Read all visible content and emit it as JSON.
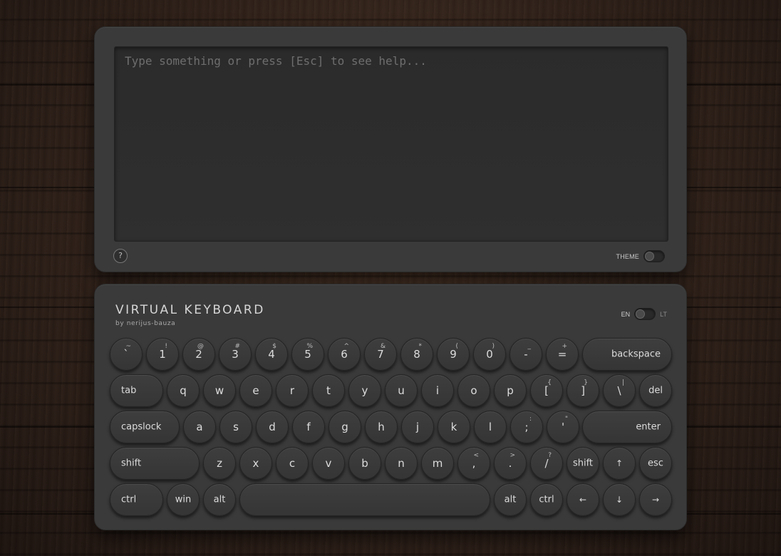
{
  "screen": {
    "placeholder": "Type something or press [Esc] to see help...",
    "help_label": "?",
    "theme_label": "THEME"
  },
  "keyboard": {
    "title": "VIRTUAL KEYBOARD",
    "author": "by nerijus-bauza",
    "lang_en": "EN",
    "lang_lt": "LT",
    "rows": [
      [
        {
          "label": "`",
          "shift": "~"
        },
        {
          "label": "1",
          "shift": "!"
        },
        {
          "label": "2",
          "shift": "@"
        },
        {
          "label": "3",
          "shift": "#"
        },
        {
          "label": "4",
          "shift": "$"
        },
        {
          "label": "5",
          "shift": "%"
        },
        {
          "label": "6",
          "shift": "^"
        },
        {
          "label": "7",
          "shift": "&"
        },
        {
          "label": "8",
          "shift": "*"
        },
        {
          "label": "9",
          "shift": "("
        },
        {
          "label": "0",
          "shift": ")"
        },
        {
          "label": "-",
          "shift": "_"
        },
        {
          "label": "=",
          "shift": "+"
        },
        {
          "label": "backspace",
          "shift": ""
        }
      ],
      [
        {
          "label": "tab",
          "shift": ""
        },
        {
          "label": "q",
          "shift": ""
        },
        {
          "label": "w",
          "shift": ""
        },
        {
          "label": "e",
          "shift": ""
        },
        {
          "label": "r",
          "shift": ""
        },
        {
          "label": "t",
          "shift": ""
        },
        {
          "label": "y",
          "shift": ""
        },
        {
          "label": "u",
          "shift": ""
        },
        {
          "label": "i",
          "shift": ""
        },
        {
          "label": "o",
          "shift": ""
        },
        {
          "label": "p",
          "shift": ""
        },
        {
          "label": "[",
          "shift": "{"
        },
        {
          "label": "]",
          "shift": "}"
        },
        {
          "label": "\\",
          "shift": "|"
        },
        {
          "label": "del",
          "shift": ""
        }
      ],
      [
        {
          "label": "capslock",
          "shift": ""
        },
        {
          "label": "a",
          "shift": ""
        },
        {
          "label": "s",
          "shift": ""
        },
        {
          "label": "d",
          "shift": ""
        },
        {
          "label": "f",
          "shift": ""
        },
        {
          "label": "g",
          "shift": ""
        },
        {
          "label": "h",
          "shift": ""
        },
        {
          "label": "j",
          "shift": ""
        },
        {
          "label": "k",
          "shift": ""
        },
        {
          "label": "l",
          "shift": ""
        },
        {
          "label": ";",
          "shift": ":"
        },
        {
          "label": "'",
          "shift": "\""
        },
        {
          "label": "enter",
          "shift": ""
        }
      ],
      [
        {
          "label": "shift",
          "shift": ""
        },
        {
          "label": "z",
          "shift": ""
        },
        {
          "label": "x",
          "shift": ""
        },
        {
          "label": "c",
          "shift": ""
        },
        {
          "label": "v",
          "shift": ""
        },
        {
          "label": "b",
          "shift": ""
        },
        {
          "label": "n",
          "shift": ""
        },
        {
          "label": "m",
          "shift": ""
        },
        {
          "label": ",",
          "shift": "<"
        },
        {
          "label": ".",
          "shift": ">"
        },
        {
          "label": "/",
          "shift": "?"
        },
        {
          "label": "shift",
          "shift": ""
        },
        {
          "label": "↑",
          "shift": ""
        },
        {
          "label": "esc",
          "shift": ""
        }
      ],
      [
        {
          "label": "ctrl",
          "shift": ""
        },
        {
          "label": "win",
          "shift": ""
        },
        {
          "label": "alt",
          "shift": ""
        },
        {
          "label": "",
          "shift": ""
        },
        {
          "label": "alt",
          "shift": ""
        },
        {
          "label": "ctrl",
          "shift": ""
        },
        {
          "label": "←",
          "shift": ""
        },
        {
          "label": "↓",
          "shift": ""
        },
        {
          "label": "→",
          "shift": ""
        }
      ]
    ]
  }
}
